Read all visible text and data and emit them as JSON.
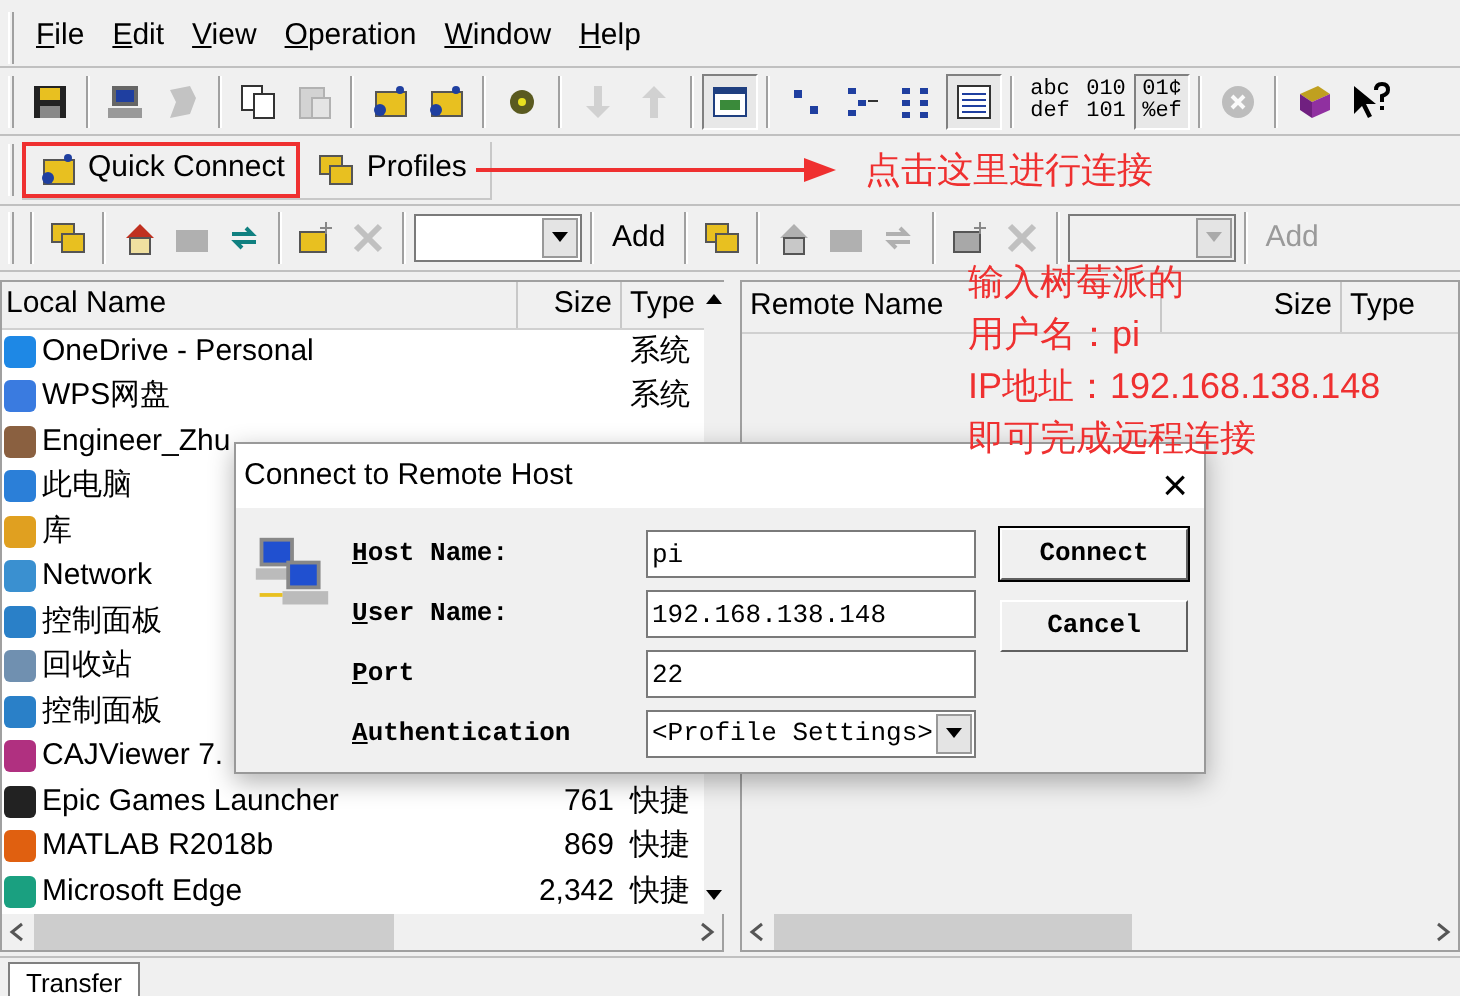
{
  "menu": [
    {
      "label": "File"
    },
    {
      "label": "Edit"
    },
    {
      "label": "View"
    },
    {
      "label": "Operation"
    },
    {
      "label": "Window"
    },
    {
      "label": "Help"
    }
  ],
  "toolbar": [
    {
      "kind": "icon",
      "disabled": false,
      "pressed": false
    },
    {
      "kind": "sep"
    },
    {
      "kind": "icon",
      "disabled": false,
      "pressed": false
    },
    {
      "kind": "icon",
      "disabled": true,
      "pressed": false
    },
    {
      "kind": "sep"
    },
    {
      "kind": "icon",
      "disabled": false,
      "pressed": false
    },
    {
      "kind": "icon",
      "disabled": true,
      "pressed": false
    },
    {
      "kind": "sep"
    },
    {
      "kind": "icon",
      "disabled": false,
      "pressed": false
    },
    {
      "kind": "icon",
      "disabled": false,
      "pressed": false
    },
    {
      "kind": "sep"
    },
    {
      "kind": "icon",
      "disabled": false,
      "pressed": false
    },
    {
      "kind": "sep"
    },
    {
      "kind": "icon",
      "disabled": true,
      "pressed": false
    },
    {
      "kind": "icon",
      "disabled": true,
      "pressed": false
    },
    {
      "kind": "sep"
    },
    {
      "kind": "icon",
      "disabled": false,
      "pressed": true
    },
    {
      "kind": "sep"
    },
    {
      "kind": "icon",
      "disabled": false,
      "pressed": false
    },
    {
      "kind": "icon",
      "disabled": false,
      "pressed": false
    },
    {
      "kind": "icon",
      "disabled": false,
      "pressed": false
    },
    {
      "kind": "icon",
      "disabled": false,
      "pressed": true
    },
    {
      "kind": "sep"
    },
    {
      "kind": "text",
      "lines": [
        "abc",
        "def"
      ],
      "pressed": false
    },
    {
      "kind": "text",
      "lines": [
        "010",
        "101"
      ],
      "pressed": false
    },
    {
      "kind": "text",
      "lines": [
        "01¢",
        "%ef"
      ],
      "pressed": true
    },
    {
      "kind": "sep"
    },
    {
      "kind": "icon",
      "disabled": true,
      "pressed": false
    },
    {
      "kind": "sep"
    },
    {
      "kind": "icon",
      "disabled": false,
      "pressed": false
    },
    {
      "kind": "icon",
      "disabled": false,
      "pressed": false
    }
  ],
  "connect_bar": [
    {
      "label": "Quick Connect",
      "highlighted": true
    },
    {
      "label": "Profiles",
      "highlighted": false
    }
  ],
  "callout_1": "点击这里进行连接",
  "local_toolbar": {
    "add": "Add",
    "disabled": false
  },
  "remote_toolbar": {
    "add": "Add",
    "disabled": true
  },
  "local_pane": {
    "columns": [
      "Local Name",
      "Size",
      "Type"
    ],
    "rows": [
      {
        "name": "OneDrive - Personal",
        "size": "",
        "type": "系统"
      },
      {
        "name": "WPS网盘",
        "size": "",
        "type": "系统"
      },
      {
        "name": "Engineer_Zhu",
        "size": "",
        "type": ""
      },
      {
        "name": "此电脑",
        "size": "",
        "type": ""
      },
      {
        "name": "库",
        "size": "",
        "type": ""
      },
      {
        "name": "Network",
        "size": "",
        "type": ""
      },
      {
        "name": "控制面板",
        "size": "",
        "type": ""
      },
      {
        "name": "回收站",
        "size": "",
        "type": ""
      },
      {
        "name": "控制面板",
        "size": "",
        "type": ""
      },
      {
        "name": "CAJViewer 7.",
        "size": "",
        "type": ""
      },
      {
        "name": "Epic Games Launcher",
        "size": "761",
        "type": "快捷"
      },
      {
        "name": "MATLAB R2018b",
        "size": "869",
        "type": "快捷"
      },
      {
        "name": "Microsoft Edge",
        "size": "2,342",
        "type": "快捷"
      }
    ]
  },
  "remote_pane": {
    "columns": [
      "Remote Name",
      "Size",
      "Type"
    ]
  },
  "callout_2": [
    "输入树莓派的",
    "用户名：pi",
    "IP地址：192.168.138.148",
    "即可完成远程连接"
  ],
  "dialog": {
    "title": "Connect to Remote Host",
    "close": "×",
    "fields": [
      {
        "label": "Host Name:",
        "kind": "input",
        "value": "pi"
      },
      {
        "label": "User Name:",
        "kind": "input",
        "value": "192.168.138.148"
      },
      {
        "label": "Port",
        "kind": "input",
        "value": "22"
      },
      {
        "label": "Authentication",
        "kind": "select",
        "value": "<Profile Settings>"
      }
    ],
    "buttons": [
      {
        "label": "Connect",
        "default": true
      },
      {
        "label": "Cancel",
        "default": false
      }
    ]
  },
  "bottom_tabs": [
    {
      "label": "Transfer",
      "selected": true
    }
  ]
}
